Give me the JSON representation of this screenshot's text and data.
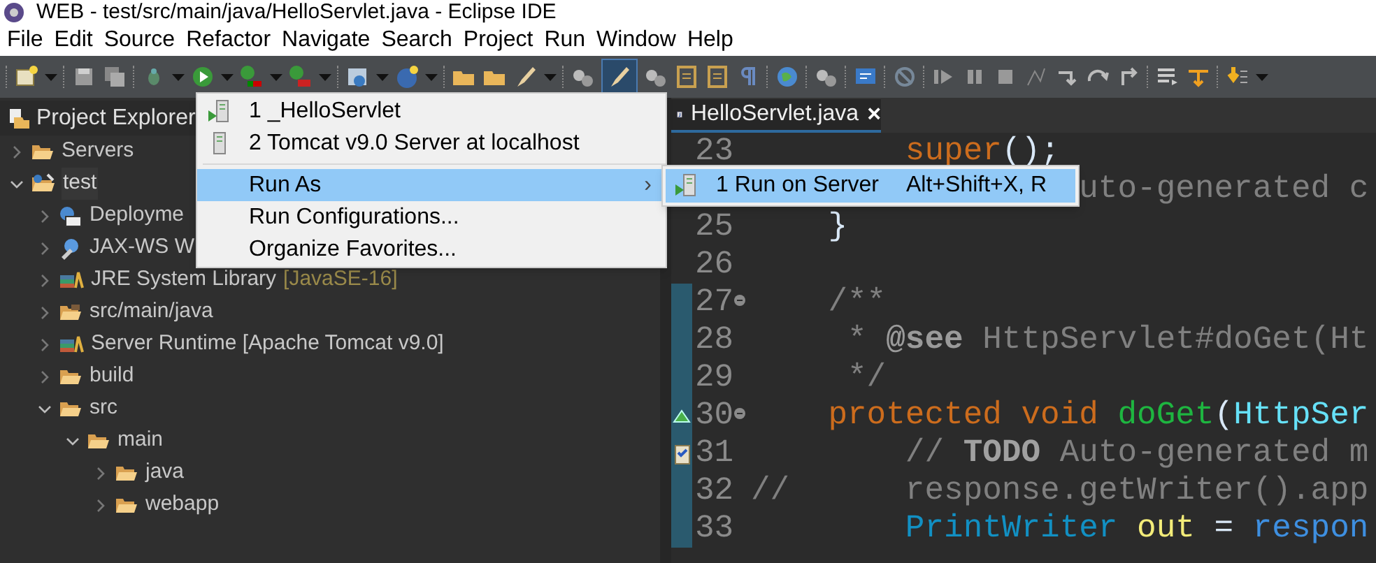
{
  "window": {
    "title": "WEB - test/src/main/java/HelloServlet.java - Eclipse IDE"
  },
  "menu_bar": [
    "File",
    "Edit",
    "Source",
    "Refactor",
    "Navigate",
    "Search",
    "Project",
    "Run",
    "Window",
    "Help"
  ],
  "project_explorer": {
    "title": "Project Explorer",
    "selected": true,
    "tree": [
      {
        "label": "Servers",
        "kind": "folder",
        "expanded": false,
        "selected": false
      },
      {
        "label": "test",
        "kind": "project",
        "expanded": true,
        "selected": true,
        "children": [
          {
            "label": "Deployme",
            "kind": "deploy",
            "expanded": false,
            "selected": false
          },
          {
            "label": "JAX-WS W",
            "kind": "webservice",
            "expanded": false,
            "selected": false
          },
          {
            "label": "JRE System Library",
            "suffix": "[JavaSE-16]",
            "kind": "library",
            "expanded": false,
            "selected": false
          },
          {
            "label": "src/main/java",
            "kind": "source",
            "expanded": false,
            "selected": false
          },
          {
            "label": "Server Runtime [Apache Tomcat v9.0]",
            "kind": "library",
            "expanded": false,
            "selected": false
          },
          {
            "label": "build",
            "kind": "folder",
            "expanded": false,
            "selected": false
          },
          {
            "label": "src",
            "kind": "folder",
            "expanded": true,
            "selected": false,
            "children": [
              {
                "label": "main",
                "kind": "folder",
                "expanded": true,
                "selected": false,
                "children": [
                  {
                    "label": "java",
                    "kind": "folder",
                    "expanded": false,
                    "selected": false
                  },
                  {
                    "label": "webapp",
                    "kind": "folder",
                    "expanded": false,
                    "selected": false
                  }
                ]
              }
            ]
          }
        ]
      }
    ]
  },
  "editor": {
    "tab": {
      "label": "HelloServlet.java",
      "close": "×",
      "selected": true
    },
    "lines": [
      {
        "number": "23",
        "kind": "plain",
        "fold": false,
        "in_range": false,
        "tokens": [
          {
            "text": "        super",
            "kind": "keyword"
          },
          {
            "text": "();",
            "kind": "plain"
          }
        ]
      },
      {
        "kind": "plain",
        "fold": false,
        "in_range": false,
        "tokens": [
          {
            "text": "                 uto-generated c",
            "kind": "comment"
          }
        ]
      },
      {
        "number": "25",
        "kind": "plain",
        "fold": false,
        "in_range": false,
        "tokens": [
          {
            "text": "    }",
            "kind": "plain"
          }
        ]
      },
      {
        "number": "26",
        "kind": "plain",
        "fold": false,
        "in_range": false
      },
      {
        "number": "27",
        "kind": "plain",
        "fold": true,
        "in_range": true,
        "tokens": [
          {
            "text": "    /**",
            "kind": "javadoc"
          }
        ]
      },
      {
        "number": "28",
        "kind": "plain",
        "fold": false,
        "in_range": true,
        "tokens": [
          {
            "text": "     * ",
            "kind": "javadoc"
          },
          {
            "text": "@see",
            "kind": "javadoc-tag"
          },
          {
            "text": " HttpServlet#doGet(Ht",
            "kind": "javadoc"
          }
        ]
      },
      {
        "number": "29",
        "kind": "plain",
        "fold": false,
        "in_range": true,
        "tokens": [
          {
            "text": "     */",
            "kind": "javadoc"
          }
        ]
      },
      {
        "number": "30",
        "kind": "override",
        "fold": true,
        "in_range": true,
        "tokens": [
          {
            "text": "    protected void ",
            "kind": "keyword"
          },
          {
            "text": "doGet",
            "kind": "method"
          },
          {
            "text": "(",
            "kind": "plain"
          },
          {
            "text": "HttpSer",
            "kind": "type"
          }
        ]
      },
      {
        "number": "31",
        "kind": "task",
        "fold": false,
        "in_range": true,
        "tokens": [
          {
            "text": "        // ",
            "kind": "comment"
          },
          {
            "text": "TODO",
            "kind": "todo"
          },
          {
            "text": " Auto-generated m",
            "kind": "comment"
          }
        ]
      },
      {
        "number": "32",
        "kind": "plain",
        "fold": false,
        "in_range": true,
        "tokens": [
          {
            "text": "//      response.getWriter().app",
            "kind": "comment"
          }
        ]
      },
      {
        "number": "33",
        "kind": "plain",
        "fold": false,
        "in_range": true,
        "tokens": [
          {
            "text": "        PrintWriter",
            "kind": "class"
          },
          {
            "text": " out",
            "kind": "variable"
          },
          {
            "text": " = ",
            "kind": "plain"
          },
          {
            "text": "respon",
            "kind": "field"
          }
        ]
      }
    ]
  },
  "context_menu": {
    "items": [
      {
        "kind": "launch",
        "label": "1 _HelloServlet",
        "selected": false
      },
      {
        "kind": "server",
        "label": "2 Tomcat v9.0 Server at localhost",
        "selected": false
      },
      {
        "kind": "separator"
      },
      {
        "kind": "submenu",
        "label": "Run As",
        "arrow": "›",
        "selected": true
      },
      {
        "kind": "action",
        "label": "Run Configurations...",
        "selected": false
      },
      {
        "kind": "action",
        "label": "Organize Favorites...",
        "selected": false
      }
    ]
  },
  "submenu": {
    "items": [
      {
        "label": "1 Run on Server",
        "shortcut": "Alt+Shift+X, R",
        "selected": true
      }
    ]
  }
}
